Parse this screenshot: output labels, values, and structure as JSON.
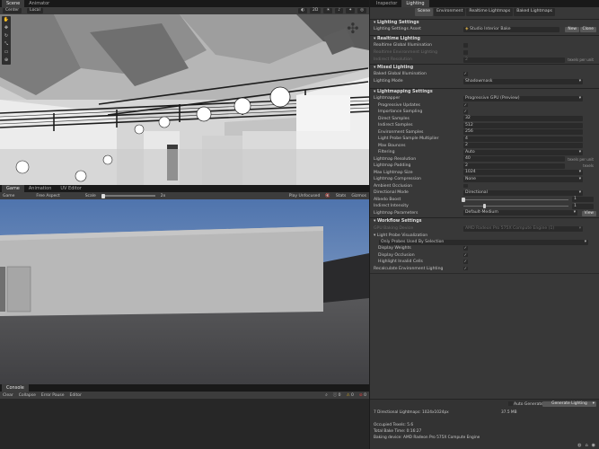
{
  "scene_tabs": [
    "Scene",
    "Animator"
  ],
  "scene_toolbar": [
    "Center",
    "Local"
  ],
  "game_tabs": [
    "Game",
    "Animation",
    "UV Editor"
  ],
  "game_toolbar": {
    "display": "Game",
    "aspect": "Free Aspect",
    "scale_label": "Scale",
    "scale_value": "2x",
    "play_mode": "Play Unfocused",
    "stats": "Stats",
    "gizmos": "Gizmos"
  },
  "console": {
    "tab": "Console",
    "buttons": [
      "Clear",
      "Collapse",
      "Error Pause",
      "Editor"
    ],
    "counts": [
      "0",
      "0",
      "0"
    ]
  },
  "inspector_tabs": [
    "Inspector",
    "Lighting"
  ],
  "lighting": {
    "subtabs": [
      "Scene",
      "Environment",
      "Realtime Lightmaps",
      "Baked Lightmaps"
    ],
    "settings_header": "Lighting Settings",
    "settings_asset_label": "Lighting Settings Asset",
    "settings_asset_value": "Studio Interior Bake",
    "new_btn": "New",
    "clone_btn": "Clone",
    "realtime": {
      "header": "Realtime Lighting",
      "rows": [
        {
          "label": "Realtime Global Illumination",
          "kind": "check",
          "value": "",
          "dim": false
        },
        {
          "label": "Realtime Environment Lighting",
          "kind": "check",
          "value": "",
          "dim": true
        },
        {
          "label": "Indirect Resolution",
          "kind": "text",
          "value": "2",
          "unit": "texels per unit",
          "dim": true
        }
      ]
    },
    "mixed": {
      "header": "Mixed Lighting",
      "rows": [
        {
          "label": "Baked Global Illumination",
          "kind": "check",
          "value": "✓"
        },
        {
          "label": "Lighting Mode",
          "kind": "dd",
          "value": "Shadowmask"
        }
      ]
    },
    "lightmapping": {
      "header": "Lightmapping Settings",
      "rows": [
        {
          "label": "Lightmapper",
          "kind": "dd",
          "value": "Progressive GPU (Preview)",
          "indent": 0
        },
        {
          "label": "Progressive Updates",
          "kind": "check",
          "value": "✓",
          "indent": 1
        },
        {
          "label": "Importance Sampling",
          "kind": "check",
          "value": "✓",
          "indent": 1
        },
        {
          "label": "Direct Samples",
          "kind": "text",
          "value": "32",
          "indent": 1
        },
        {
          "label": "Indirect Samples",
          "kind": "text",
          "value": "512",
          "indent": 1
        },
        {
          "label": "Environment Samples",
          "kind": "text",
          "value": "256",
          "indent": 1
        },
        {
          "label": "Light Probe Sample Multiplier",
          "kind": "text",
          "value": "4",
          "indent": 1
        },
        {
          "label": "Max Bounces",
          "kind": "text",
          "value": "2",
          "indent": 1
        },
        {
          "label": "Filtering",
          "kind": "dd",
          "value": "Auto",
          "indent": 1
        },
        {
          "label": "Lightmap Resolution",
          "kind": "text",
          "value": "40",
          "unit": "texels per unit",
          "indent": 0
        },
        {
          "label": "Lightmap Padding",
          "kind": "text",
          "value": "2",
          "unit": "texels",
          "indent": 0
        },
        {
          "label": "Max Lightmap Size",
          "kind": "dd",
          "value": "1024",
          "indent": 0
        },
        {
          "label": "Lightmap Compression",
          "kind": "dd",
          "value": "None",
          "indent": 0
        },
        {
          "label": "Ambient Occlusion",
          "kind": "check",
          "value": "",
          "indent": 0
        },
        {
          "label": "Directional Mode",
          "kind": "dd",
          "value": "Directional",
          "indent": 0
        },
        {
          "label": "Albedo Boost",
          "kind": "slider",
          "value": "1",
          "fraction": 0.0,
          "indent": 0
        },
        {
          "label": "Indirect Intensity",
          "kind": "slider",
          "value": "1",
          "fraction": 0.2,
          "indent": 0
        },
        {
          "label": "Lightmap Parameters",
          "kind": "dd",
          "value": "Default-Medium",
          "indent": 0
        }
      ],
      "view_btn": "View"
    },
    "workflow": {
      "header": "Workflow Settings",
      "gpu_label": "GPU Baking Device",
      "gpu_value": "AMD Radeon Pro 575X Compute Engine (1)",
      "probe_label": "Light Probe Visualization",
      "probe_value": "Only Probes Used By Selection",
      "rows": [
        {
          "label": "Display Weights",
          "value": "✓",
          "indent": 1
        },
        {
          "label": "Display Occlusion",
          "value": "✓",
          "indent": 1
        },
        {
          "label": "Highlight Invalid Cells",
          "value": "✓",
          "indent": 1
        },
        {
          "label": "Recalculate Environment Lighting",
          "value": "✓",
          "indent": 0
        }
      ]
    },
    "auto_generate": "Auto Generate",
    "generate_btn": "Generate Lighting",
    "stats_lightmaps": "7 Directional Lightmaps: 1024x1024px",
    "stats_size": "37.5 MB",
    "occupied_texels": "Occupied Texels: 5.6",
    "total_bake_time": "Total Bake Time: 0:16:27",
    "baking_device": "Baking device: AMD Radeon Pro 575X Compute Engine"
  }
}
